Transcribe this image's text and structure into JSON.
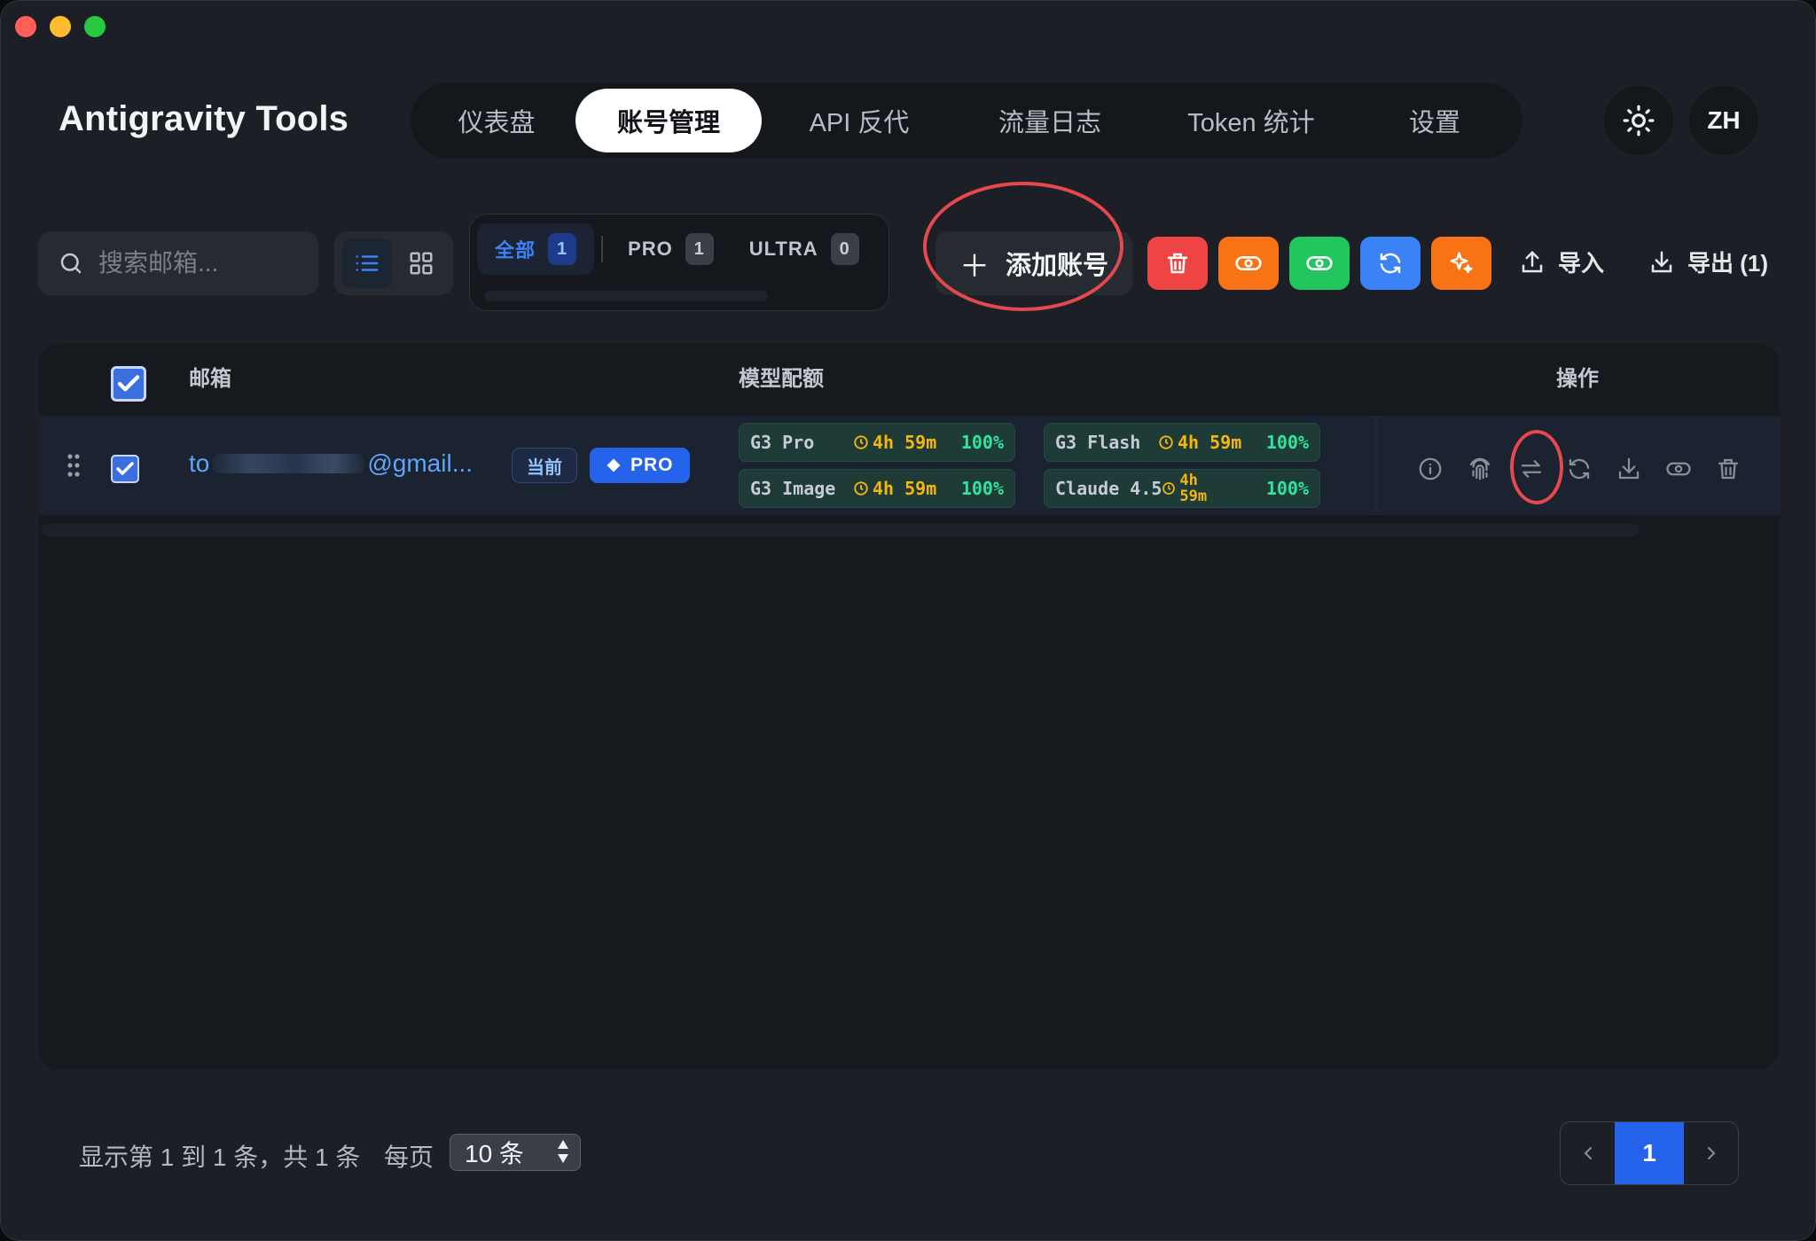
{
  "app": {
    "title": "Antigravity Tools"
  },
  "nav": {
    "tabs": [
      {
        "label": "仪表盘",
        "active": false
      },
      {
        "label": "账号管理",
        "active": true
      },
      {
        "label": "API 反代",
        "active": false
      },
      {
        "label": "流量日志",
        "active": false
      },
      {
        "label": "Token 统计",
        "active": false
      },
      {
        "label": "设置",
        "active": false
      }
    ],
    "lang_label": "ZH"
  },
  "toolbar": {
    "search_placeholder": "搜索邮箱...",
    "filters": [
      {
        "label": "全部",
        "count": "1",
        "active": true
      },
      {
        "label": "PRO",
        "count": "1",
        "active": false
      },
      {
        "label": "ULTRA",
        "count": "0",
        "active": false
      }
    ],
    "add_label": "添加账号",
    "import_label": "导入",
    "export_label": "导出 (1)",
    "colors": {
      "delete": "#ef4444",
      "disable": "#f97316",
      "enable": "#22c55e",
      "refresh": "#3b82f6",
      "optimize": "#f97316"
    }
  },
  "table": {
    "headers": {
      "email": "邮箱",
      "quota": "模型配额",
      "actions": "操作"
    },
    "rows": [
      {
        "email_start": "to",
        "email_end": "@gmail...",
        "current_badge": "当前",
        "plan_badge": "PRO",
        "quotas": [
          {
            "name": "G3 Pro",
            "time": "4h 59m",
            "pct": "100%"
          },
          {
            "name": "G3 Flash",
            "time": "4h 59m",
            "pct": "100%"
          },
          {
            "name": "G3 Image",
            "time": "4h 59m",
            "pct": "100%"
          },
          {
            "name": "Claude 4.5",
            "time_line1": "4h",
            "time_line2": "59m",
            "pct": "100%"
          }
        ]
      }
    ]
  },
  "footer": {
    "summary": "显示第 1 到 1 条，共 1 条",
    "per_page_label": "每页",
    "page_size": "10 条",
    "current_page": "1"
  }
}
